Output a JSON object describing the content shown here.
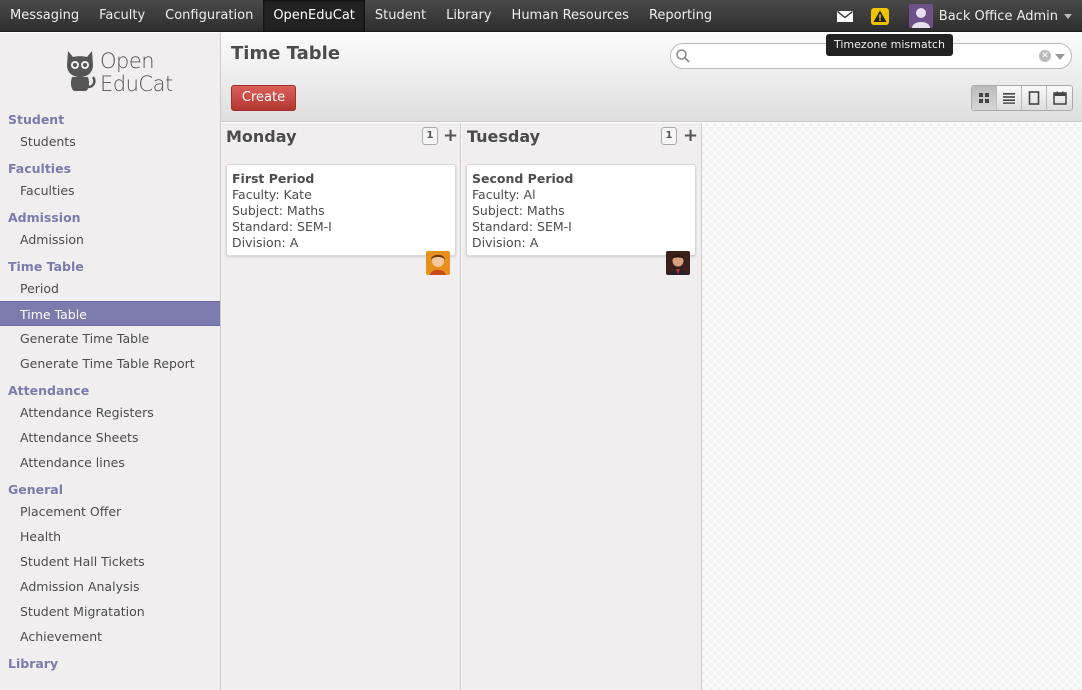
{
  "topbar": {
    "menu": [
      "Messaging",
      "Faculty",
      "Configuration",
      "OpenEduCat",
      "Student",
      "Library",
      "Human Resources",
      "Reporting"
    ],
    "active_menu": "OpenEduCat",
    "user_name": "Back Office Admin",
    "tooltip": "Timezone mismatch",
    "icons": [
      "mail-icon",
      "warning-icon",
      "user-avatar"
    ]
  },
  "logo": {
    "line1": "Open",
    "line2": "EduCat"
  },
  "sidebar": {
    "sections": [
      {
        "title": "Student",
        "items": [
          "Students"
        ]
      },
      {
        "title": "Faculties",
        "items": [
          "Faculties"
        ]
      },
      {
        "title": "Admission",
        "items": [
          "Admission"
        ]
      },
      {
        "title": "Time Table",
        "items": [
          "Period",
          "Time Table",
          "Generate Time Table",
          "Generate Time Table Report"
        ]
      },
      {
        "title": "Attendance",
        "items": [
          "Attendance Registers",
          "Attendance Sheets",
          "Attendance lines"
        ]
      },
      {
        "title": "General",
        "items": [
          "Placement Offer",
          "Health",
          "Student Hall Tickets",
          "Admission Analysis",
          "Student Migratation",
          "Achievement"
        ]
      },
      {
        "title": "Library",
        "items": []
      }
    ],
    "active_item": "Time Table"
  },
  "main": {
    "title": "Time Table",
    "create_label": "Create",
    "search_placeholder": "",
    "views": [
      "kanban",
      "list",
      "form",
      "calendar"
    ],
    "active_view": "kanban"
  },
  "kanban": {
    "columns": [
      {
        "title": "Monday",
        "count": "1",
        "cards": [
          {
            "title": "First Period",
            "lines": [
              "Faculty: Kate",
              "Subject: Maths",
              "Standard: SEM-I",
              "Division: A"
            ],
            "avatar_color": "#e8901c"
          }
        ]
      },
      {
        "title": "Tuesday",
        "count": "1",
        "cards": [
          {
            "title": "Second Period",
            "lines": [
              "Faculty: Al",
              "Subject: Maths",
              "Standard: SEM-I",
              "Division: A"
            ],
            "avatar_color": "#5a2a22"
          }
        ]
      }
    ]
  },
  "colors": {
    "accent": "#7c7bad",
    "create": "#c9433d",
    "topbar": "#3a3a3a"
  }
}
